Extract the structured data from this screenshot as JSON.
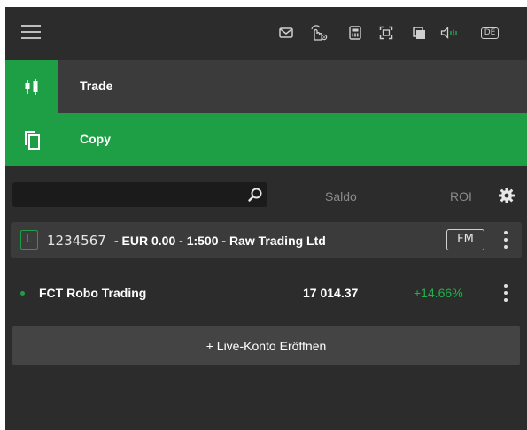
{
  "toolbar": {
    "icons": [
      "menu-icon",
      "mail-icon",
      "touch-settings-icon",
      "calculator-icon",
      "fullscreen-icon",
      "windows-icon",
      "sound-icon",
      "language-icon"
    ],
    "language_label": "DE"
  },
  "nav": {
    "items": [
      {
        "label": "Trade",
        "icon": "candlestick-icon",
        "active": false
      },
      {
        "label": "Copy",
        "icon": "copy-icon",
        "active": true
      }
    ]
  },
  "search": {
    "placeholder": "",
    "value": ""
  },
  "columns": {
    "saldo": "Saldo",
    "roi": "ROI"
  },
  "account": {
    "badge": "L",
    "number": "1234567",
    "details": "- EUR 0.00 - 1:500 - Raw Trading Ltd",
    "fm_label": "FM"
  },
  "strategies": [
    {
      "name": "FCT Robo Trading",
      "saldo": "17 014.37",
      "roi": "+14.66%"
    }
  ],
  "live_account_button": "+ Live-Konto Eröffnen",
  "colors": {
    "accent": "#1e9e45",
    "background": "#2c2c2c",
    "positive": "#22b14c"
  }
}
